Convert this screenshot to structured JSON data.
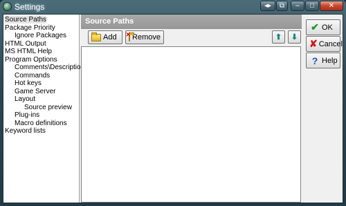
{
  "window": {
    "title": "Settings",
    "controls": [
      "◂▸",
      "⧉",
      "–",
      "□",
      "✕"
    ]
  },
  "tree": {
    "items": [
      {
        "label": "Source Paths",
        "level": 0,
        "selected": true
      },
      {
        "label": "Package Priority",
        "level": 0
      },
      {
        "label": "Ignore Packages",
        "level": 1
      },
      {
        "label": "HTML Output",
        "level": 0
      },
      {
        "label": "MS HTML Help",
        "level": 0
      },
      {
        "label": "Program Options",
        "level": 0
      },
      {
        "label": "Comments\\Descriptions",
        "level": 1
      },
      {
        "label": "Commands",
        "level": 1
      },
      {
        "label": "Hot keys",
        "level": 1
      },
      {
        "label": "Game Server",
        "level": 1
      },
      {
        "label": "Layout",
        "level": 1
      },
      {
        "label": "Source preview",
        "level": 2
      },
      {
        "label": "Plug-ins",
        "level": 1
      },
      {
        "label": "Macro definitions",
        "level": 1
      },
      {
        "label": "Keyword lists",
        "level": 0
      }
    ]
  },
  "panel": {
    "header": "Source Paths",
    "add_label": "Add",
    "remove_label": "Remove",
    "up_glyph": "⬆",
    "down_glyph": "⬇"
  },
  "side_buttons": {
    "ok_label": "OK",
    "cancel_label": "Cancel",
    "help_label": "Help",
    "ok_glyph": "✔",
    "cancel_glyph": "✘",
    "help_glyph": "?"
  }
}
